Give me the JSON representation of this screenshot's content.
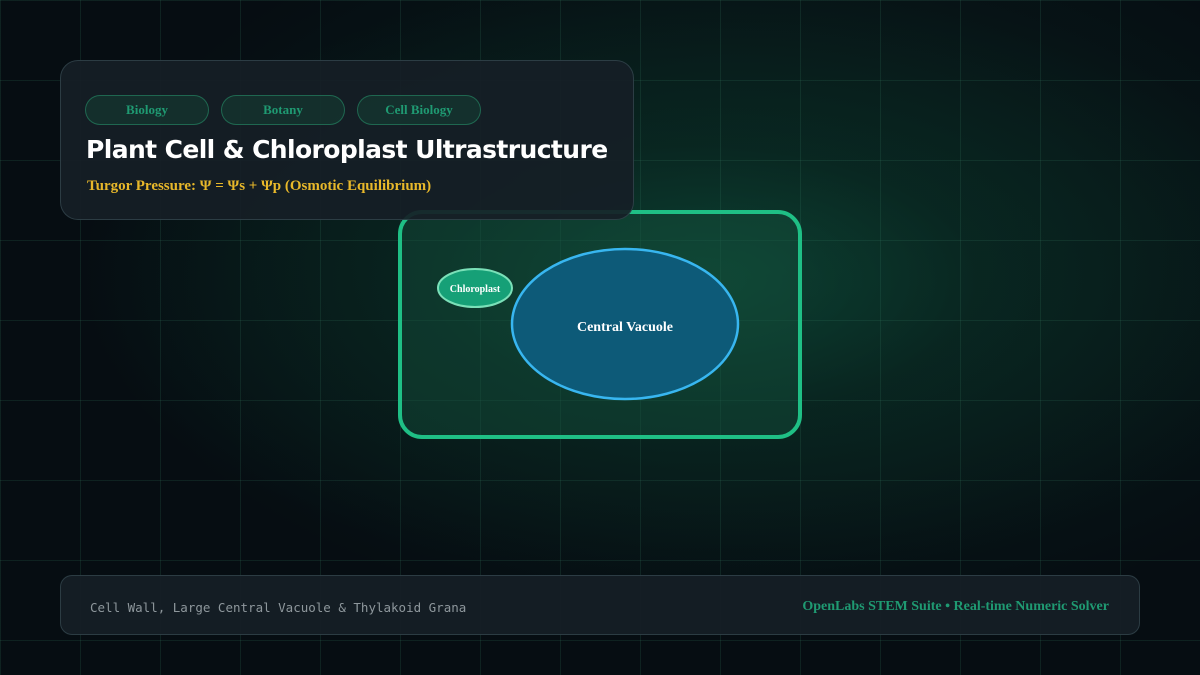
{
  "header": {
    "tags": [
      "Biology",
      "Botany",
      "Cell Biology"
    ],
    "title": "Plant Cell & Chloroplast Ultrastructure",
    "formula": "Turgor Pressure: Ψ = Ψs + Ψp (Osmotic Equilibrium)"
  },
  "diagram": {
    "vacuole_label": "Central Vacuole",
    "chloroplast_label": "Chloroplast"
  },
  "footer": {
    "caption": "Cell Wall, Large Central Vacuole & Thylakoid Grana",
    "credit": "OpenLabs STEM Suite • Real-time Numeric Solver"
  },
  "colors": {
    "cell_wall": "#1fbf85",
    "vacuole_stroke": "#38b6f0",
    "vacuole_fill": "#0d5a78",
    "chloroplast_fill": "#16a077",
    "accent": "#1f9a72",
    "formula": "#e8b82a"
  }
}
